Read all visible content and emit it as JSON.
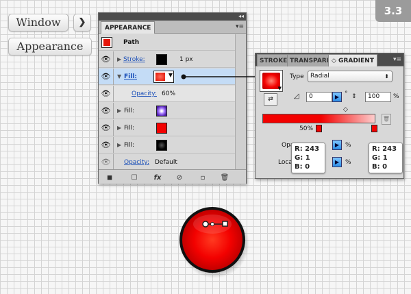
{
  "breadcrumb": {
    "window_label": "Window",
    "arrow_glyph": "❯",
    "appearance_label": "Appearance"
  },
  "step_badge": "3.3",
  "appearance_panel": {
    "collapse_glyph": "◂◂",
    "tab_label": "APPEARANCE",
    "menu_glyph": "▾≡",
    "path_label": "Path",
    "rows": {
      "stroke": {
        "label": "Stroke:",
        "weight": "1 px"
      },
      "fill_selected": {
        "label": "Fill:",
        "opacity_label": "Opacity:",
        "opacity_value": "60%"
      },
      "fill_violet": {
        "label": "Fill:"
      },
      "fill_red": {
        "label": "Fill:"
      },
      "fill_black": {
        "label": "Fill:"
      },
      "opacity": {
        "label": "Opacity:",
        "value": "Default"
      }
    },
    "footer_icons": [
      "new-art-basic-appearance-icon",
      "clear-appearance-icon",
      "add-effect-icon",
      "no-icon",
      "duplicate-icon",
      "delete-icon"
    ],
    "fx_glyph": "fx"
  },
  "gradient_panel": {
    "tabs": {
      "stroke": "STROKE",
      "transparency": "TRANSPARE",
      "gradient": "◇ GRADIENT"
    },
    "type_label": "Type",
    "type_value": "Radial",
    "angle_value": "0",
    "degree_sign": "°",
    "aspect_value": "100",
    "percent_sign": "%",
    "location_value": "50%",
    "opacity_label": "Opa",
    "location_label": "Loca",
    "pct1": "%",
    "pct2": "%"
  },
  "callouts": [
    {
      "r": "R: 243",
      "g": "G: 1",
      "b": "B: 0"
    },
    {
      "r": "R: 243",
      "g": "G: 1",
      "b": "B: 0"
    }
  ],
  "colors": {
    "accent_red": "#f30100",
    "selection_blue": "#c4dcf6",
    "link_blue": "#1a4fb8"
  }
}
